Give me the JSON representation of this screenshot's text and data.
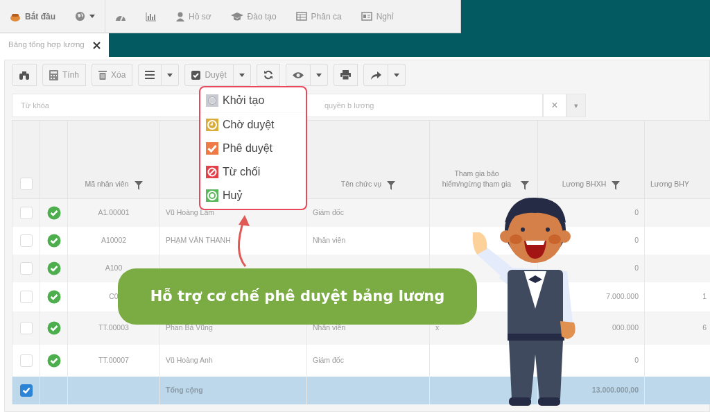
{
  "menu_bar": {
    "items": [
      {
        "kind": "start",
        "label": "Bắt đầu"
      },
      {
        "kind": "globe"
      },
      {
        "kind": "dashboard"
      },
      {
        "kind": "chart"
      },
      {
        "kind": "user",
        "label": "Hồ sơ"
      },
      {
        "kind": "cap",
        "label": "Đào tạo"
      },
      {
        "kind": "table",
        "label": "Phân ca"
      },
      {
        "kind": "card",
        "label": "Nghỉ"
      }
    ]
  },
  "tabs": [
    {
      "label": "Bảng tổng hợp lương",
      "selected": true
    }
  ],
  "toolbar": [
    {
      "kind": "binoculars"
    },
    {
      "kind": "calc",
      "label": "Tính"
    },
    {
      "kind": "trash",
      "label": "Xóa"
    },
    {
      "kind": "menu",
      "caret": true
    },
    {
      "kind": "check",
      "label": "Duyệt",
      "caret": true
    },
    {
      "kind": "refresh"
    },
    {
      "kind": "eye",
      "caret": true
    },
    {
      "kind": "print"
    },
    {
      "kind": "share",
      "caret": true
    }
  ],
  "approve_menu": [
    {
      "kind": "circle",
      "label": "Khởi tạo",
      "color": "#c8ccd2"
    },
    {
      "kind": "clock",
      "label": "Chờ duyệt",
      "color": "#d9ad3c"
    },
    {
      "kind": "check",
      "label": "Phê duyệt",
      "color": "#ee7a45"
    },
    {
      "kind": "ban",
      "label": "Từ chối",
      "color": "#e2434b"
    },
    {
      "kind": "cancel",
      "label": "Huỷ",
      "color": "#5cb85c"
    }
  ],
  "filter": {
    "keyword_placeholder": "Từ khóa",
    "scope_placeholder": "quyền b lương",
    "clear": "×",
    "caret": "▾"
  },
  "table": {
    "select_all": false,
    "columns": {
      "code": "Mã nhân viên",
      "position": "Tên chức vụ",
      "insurance": "Tham gia bảo hiểm/ngừng tham gia",
      "bhxh": "Lương BHXH",
      "bhyt": "Lương BHY"
    },
    "rows": [
      {
        "checked": false,
        "approved": true,
        "code": "A1.00001",
        "name": "Vũ Hoàng Lâm",
        "position": "Giám đốc",
        "bhxh": "0"
      },
      {
        "checked": false,
        "approved": true,
        "code": "A10002",
        "name": "PHẠM VĂN THANH",
        "position": "Nhân viên",
        "bhxh": "0"
      },
      {
        "checked": false,
        "approved": true,
        "code": "A100",
        "bhxh": "0"
      },
      {
        "checked": false,
        "approved": true,
        "code": "C0",
        "bhxh": "7.000.000",
        "bhyt": "1"
      },
      {
        "checked": false,
        "approved": true,
        "code": "TT.00003",
        "name": "Phan Bá Vũng",
        "position": "Nhân viên",
        "insurance": "x",
        "bhxh": "000.000",
        "bhyt": "6"
      },
      {
        "checked": false,
        "approved": true,
        "code": "TT.00007",
        "name": "Vũ Hoàng Anh",
        "position": "Giám đốc",
        "bhxh": "0"
      }
    ],
    "total": {
      "checked": true,
      "label": "Tổng cộng",
      "bhxh": "13.000.000,00"
    }
  },
  "banner": {
    "text": "Hỗ trợ cơ chế phê duyệt bảng lương"
  }
}
